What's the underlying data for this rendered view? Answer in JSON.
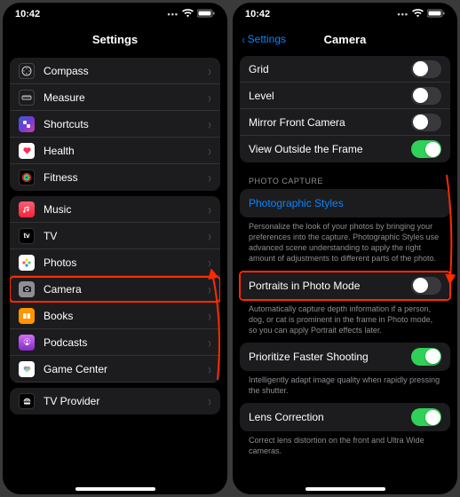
{
  "status": {
    "time": "10:42"
  },
  "left": {
    "title": "Settings",
    "group1": [
      {
        "label": "Compass"
      },
      {
        "label": "Measure"
      },
      {
        "label": "Shortcuts"
      },
      {
        "label": "Health"
      },
      {
        "label": "Fitness"
      }
    ],
    "group2": [
      {
        "label": "Music"
      },
      {
        "label": "TV"
      },
      {
        "label": "Photos"
      },
      {
        "label": "Camera"
      },
      {
        "label": "Books"
      },
      {
        "label": "Podcasts"
      },
      {
        "label": "Game Center"
      }
    ],
    "group3": [
      {
        "label": "TV Provider"
      }
    ]
  },
  "right": {
    "back": "Settings",
    "title": "Camera",
    "toggles": {
      "grid": "Grid",
      "level": "Level",
      "mirror": "Mirror Front Camera",
      "view_outside": "View Outside the Frame"
    },
    "section_header": "PHOTO CAPTURE",
    "photographic_styles": "Photographic Styles",
    "ps_desc": "Personalize the look of your photos by bringing your preferences into the capture. Photographic Styles use advanced scene understanding to apply the right amount of adjustments to different parts of the photo.",
    "portraits": "Portraits in Photo Mode",
    "portraits_desc": "Automatically capture depth information if a person, dog, or cat is prominent in the frame in Photo mode, so you can apply Portrait effects later.",
    "prioritize": "Prioritize Faster Shooting",
    "prioritize_desc": "Intelligently adapt image quality when rapidly pressing the shutter.",
    "lens": "Lens Correction",
    "lens_desc": "Correct lens distortion on the front and Ultra Wide cameras."
  }
}
